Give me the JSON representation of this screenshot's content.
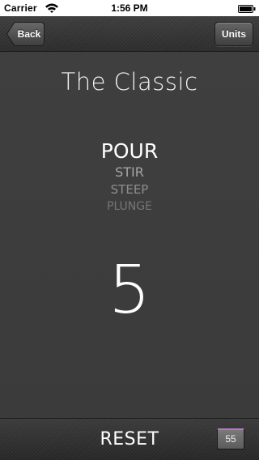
{
  "status_bar": {
    "carrier": "Carrier",
    "time": "1:56 PM",
    "wifi_icon": "wifi-icon",
    "battery_icon": "battery-icon"
  },
  "nav": {
    "back_label": "Back",
    "units_label": "Units"
  },
  "main": {
    "title": "The Classic",
    "steps": [
      {
        "label": "POUR",
        "active": true
      },
      {
        "label": "STIR",
        "active": false
      },
      {
        "label": "STEEP",
        "active": false
      },
      {
        "label": "PLUNGE",
        "active": false
      }
    ],
    "countdown": "5"
  },
  "footer": {
    "reset_label": "RESET",
    "time_badge": "55"
  },
  "colors": {
    "background": "#3e3e3e",
    "accent": "#c077d3"
  }
}
